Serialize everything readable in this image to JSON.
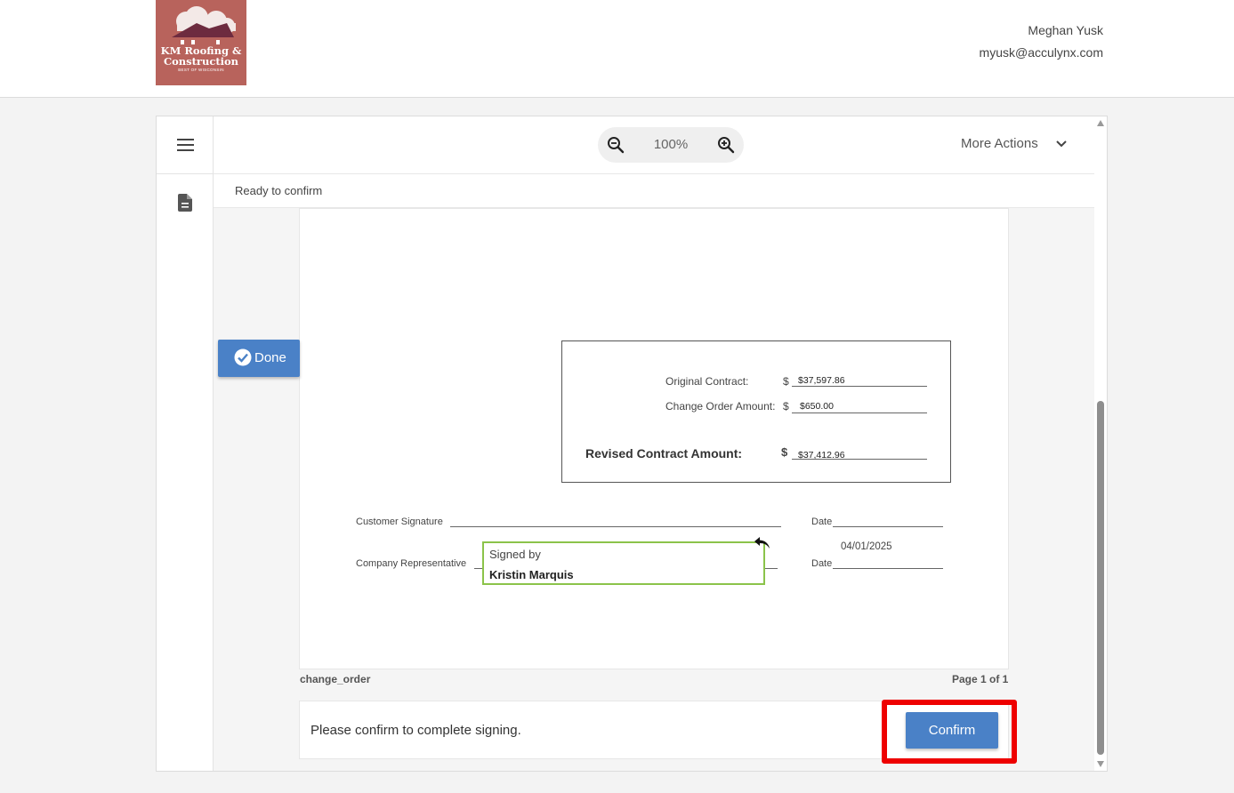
{
  "header": {
    "logo": {
      "line1": "KM Roofing &",
      "line2": "Construction",
      "tagline": "BEST OF WISCONSIN"
    },
    "user": {
      "name": "Meghan Yusk",
      "email": "myusk@acculynx.com"
    }
  },
  "toolbar": {
    "zoom_value": "100%",
    "more_actions_label": "More Actions"
  },
  "status": {
    "text": "Ready to confirm"
  },
  "document": {
    "done_label": "Done",
    "contract": {
      "original_label": "Original Contract:",
      "original_dollar": "$",
      "original_amount": "$37,597.86",
      "change_label": "Change Order Amount:",
      "change_dollar": "$",
      "change_amount": "$650.00",
      "revised_label": "Revised Contract Amount:",
      "revised_dollar": "$",
      "revised_amount": "$37,412.96"
    },
    "signatures": {
      "customer_label": "Customer Signature",
      "date_label_1": "Date",
      "rep_label": "Company Representative",
      "date_label_2": "Date",
      "signed_by_label": "Signed by",
      "signer_name": "Kristin Marquis",
      "date_value": "04/01/2025"
    },
    "file_name": "change_order",
    "page_indicator": "Page 1 of 1"
  },
  "confirm": {
    "message": "Please confirm to complete signing.",
    "button_label": "Confirm"
  },
  "colors": {
    "accent_blue": "#4a81c7",
    "logo_bg": "#b8635c",
    "signed_border": "#8bc34a",
    "highlight_red": "#ee0000"
  },
  "icons": [
    "menu-icon",
    "document-icon",
    "zoom-out-icon",
    "zoom-in-icon",
    "chevron-down-icon",
    "check-circle-icon",
    "undo-icon"
  ]
}
